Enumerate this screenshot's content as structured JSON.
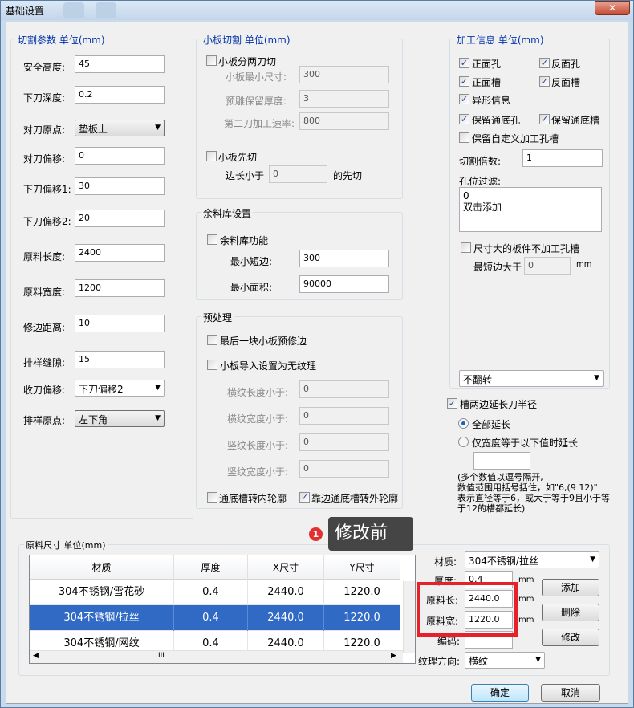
{
  "window": {
    "title": "基础设置",
    "close_glyph": "✕"
  },
  "cut_params": {
    "title": "切割参数 单位(mm)",
    "fields": [
      {
        "label": "安全高度:",
        "value": "45"
      },
      {
        "label": "下刀深度:",
        "value": "0.2"
      },
      {
        "label": "对刀偏移:",
        "value": "0"
      },
      {
        "label": "下刀偏移1:",
        "value": "30"
      },
      {
        "label": "下刀偏移2:",
        "value": "20"
      },
      {
        "label": "原料长度:",
        "value": "2400"
      },
      {
        "label": "原料宽度:",
        "value": "1200"
      },
      {
        "label": "修边距离:",
        "value": "10"
      },
      {
        "label": "排样缝隙:",
        "value": "15"
      }
    ],
    "origin_label": "对刀原点:",
    "origin_value": "垫板上",
    "retract_label": "收刀偏移:",
    "retract_value": "下刀偏移2",
    "layout_origin_label": "排样原点:",
    "layout_origin_value": "左下角"
  },
  "small_cut": {
    "title": "小板切割 单位(mm)",
    "two_cut_label": "小板分两刀切",
    "min_size_label": "小板最小尺寸:",
    "min_size_value": "300",
    "reserve_label": "预雕保留厚度:",
    "reserve_value": "3",
    "speed_label": "第二刀加工速率:",
    "speed_value": "800",
    "first_cut_label": "小板先切",
    "edge_lt_label": "边长小于",
    "edge_lt_value": "0",
    "edge_lt_suffix": "的先切"
  },
  "remnant": {
    "title": "余料库设置",
    "enable_label": "余料库功能",
    "min_edge_label": "最小短边:",
    "min_edge_value": "300",
    "min_area_label": "最小面积:",
    "min_area_value": "90000"
  },
  "preprocess": {
    "title": "预处理",
    "last_trim_label": "最后一块小板预修边",
    "no_grain_label": "小板导入设置为无纹理",
    "rows": [
      {
        "label": "横纹长度小于:",
        "value": "0"
      },
      {
        "label": "横纹宽度小于:",
        "value": "0"
      },
      {
        "label": "竖纹长度小于:",
        "value": "0"
      },
      {
        "label": "竖纹宽度小于:",
        "value": "0"
      }
    ],
    "groove_inner_label": "通底槽转内轮廓",
    "groove_outer_label": "靠边通底槽转外轮廓"
  },
  "process_info": {
    "title": "加工信息 单位(mm)",
    "front_hole": "正面孔",
    "back_hole": "反面孔",
    "front_groove": "正面槽",
    "back_groove": "反面槽",
    "shaped": "异形信息",
    "keep_hole": "保留通底孔",
    "keep_groove": "保留通底槽",
    "keep_custom": "保留自定义加工孔槽",
    "mult_label": "切割倍数:",
    "mult_value": "1",
    "filter_label": "孔位过滤:",
    "filter_lines": [
      "0",
      "双击添加"
    ],
    "big_no_hole": "尺寸大的板件不加工孔槽",
    "min_edge_gt_label": "最短边大于",
    "min_edge_gt_value": "0",
    "mm": "mm",
    "flip_value": "不翻转"
  },
  "groove_ext": {
    "label": "槽两边延长刀半径",
    "all_label": "全部延长",
    "width_label": "仅宽度等于以下值时延长",
    "note": [
      "(多个数值以逗号隔开,",
      "数值范围用括号括住，如\"6,(9 12)\"",
      "表示直径等于6，或大于等于9且小于等",
      "于12的槽都延长)"
    ]
  },
  "material": {
    "title": "原料尺寸 单位(mm)",
    "columns": [
      "材质",
      "厚度",
      "X尺寸",
      "Y尺寸"
    ],
    "rows": [
      [
        "304不锈钢/雪花砂",
        "0.4",
        "2440.0",
        "1220.0"
      ],
      [
        "304不锈钢/拉丝",
        "0.4",
        "2440.0",
        "1220.0"
      ],
      [
        "304不锈钢/网纹",
        "0.4",
        "2440.0",
        "1220.0"
      ]
    ],
    "scroll_thumb": "III",
    "mat_label": "材质:",
    "mat_value": "304不锈钢/拉丝",
    "thick_label": "厚度:",
    "thick_value": "0.4",
    "len_label": "原料长:",
    "len_value": "2440.0",
    "wid_label": "原料宽:",
    "wid_value": "1220.0",
    "code_label": "编码:",
    "grain_label": "纹理方向:",
    "grain_value": "横纹",
    "mm": "mm",
    "add": "添加",
    "delete": "删除",
    "modify": "修改"
  },
  "annotation": {
    "badge": "1",
    "text": "修改前"
  },
  "footer": {
    "ok": "确定",
    "cancel": "取消"
  },
  "colors": {
    "selected_row": "#316ac5",
    "group_title": "#0033aa",
    "highlight_box": "#e8202a"
  }
}
